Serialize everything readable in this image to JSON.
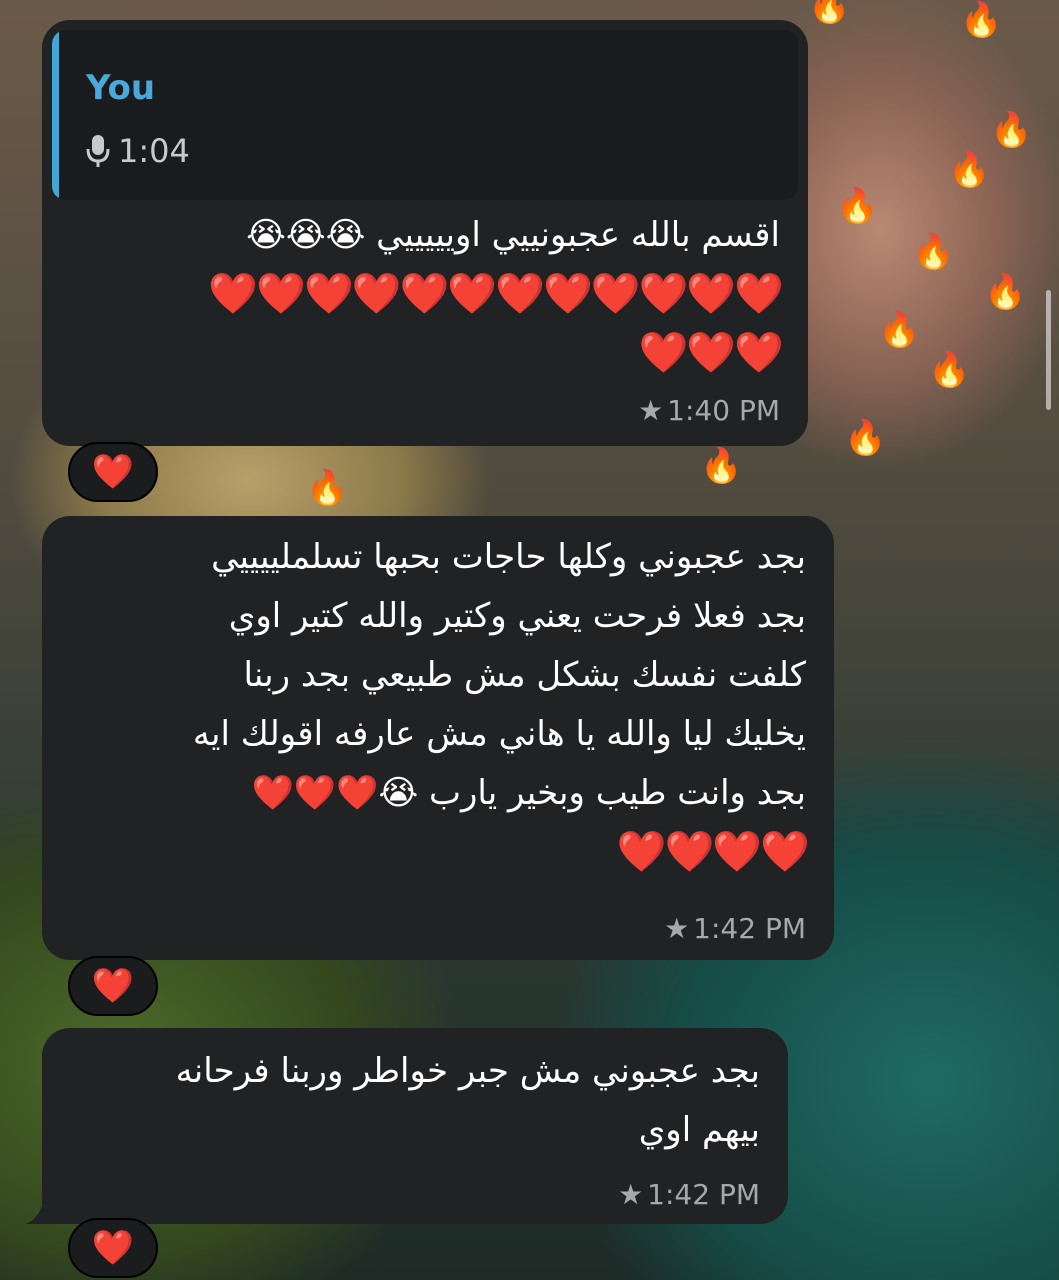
{
  "messages": [
    {
      "reply_to": {
        "name": "You",
        "voice_duration": "1:04"
      },
      "text": "اقسم بالله عجبونييي اويييييي 😭😭😭",
      "hearts_line1": "❤️❤️❤️❤️❤️❤️❤️❤️❤️❤️❤️❤️",
      "hearts_line2": "❤️❤️❤️",
      "time": "1:40 PM",
      "reaction": "❤️"
    },
    {
      "text": "بجد عجبوني وكلها حاجات بحبها تسلملييييي\nبجد فعلا فرحت يعني وكتير والله كتير اوي\nكلفت نفسك بشكل مش طبيعي بجد ربنا\nيخليك ليا والله يا هاني مش عارفه اقولك ايه\nبجد وانت طيب وبخير يارب 😭❤️❤️❤️",
      "hearts_line1": "❤️❤️❤️❤️",
      "time": "1:42 PM",
      "reaction": "❤️"
    },
    {
      "text": "بجد عجبوني مش جبر خواطر وربنا فرحانه\nبيهم اوي",
      "time": "1:42 PM",
      "reaction": "❤️"
    }
  ],
  "icons": {
    "star": "star-icon",
    "mic": "microphone-icon"
  },
  "colors": {
    "bubble": "#212224",
    "reply_accent": "#43a6d6",
    "meta": "#a7a8ac"
  }
}
